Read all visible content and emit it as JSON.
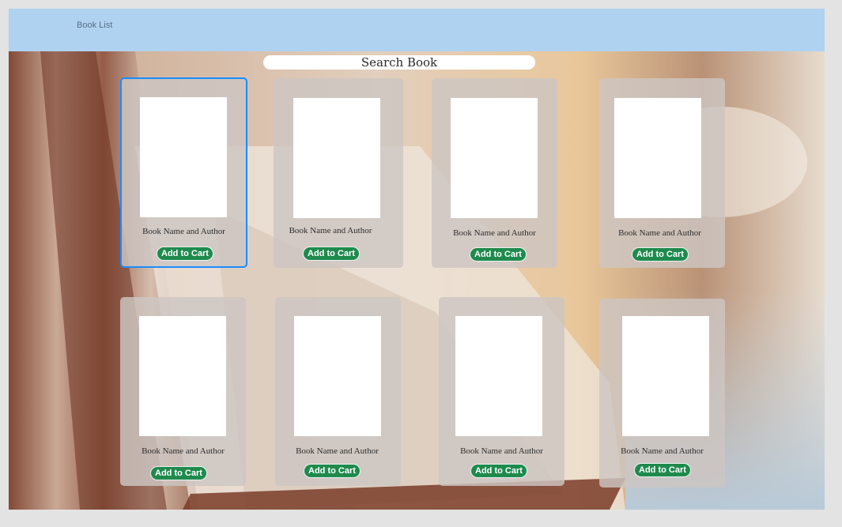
{
  "header": {
    "title": "Book List"
  },
  "search": {
    "label": "Search Book"
  },
  "books": [
    {
      "name": "Book Name and Author",
      "button": "Add to Cart",
      "selected": true
    },
    {
      "name": "Book Name and Author",
      "button": "Add to Cart"
    },
    {
      "name": "Book Name and Author",
      "button": "Add to Cart"
    },
    {
      "name": "Book Name and Author",
      "button": "Add to Cart"
    },
    {
      "name": "Book Name and Author",
      "button": "Add to Cart"
    },
    {
      "name": "Book Name and Author",
      "button": "Add to Cart"
    },
    {
      "name": "Book Name and Author",
      "button": "Add to Cart"
    },
    {
      "name": "Book Name and Author",
      "button": "Add to Cart"
    }
  ],
  "colors": {
    "header": "#aed2f0",
    "accent_button": "#1f8a4d",
    "selection": "#1a8cff"
  }
}
